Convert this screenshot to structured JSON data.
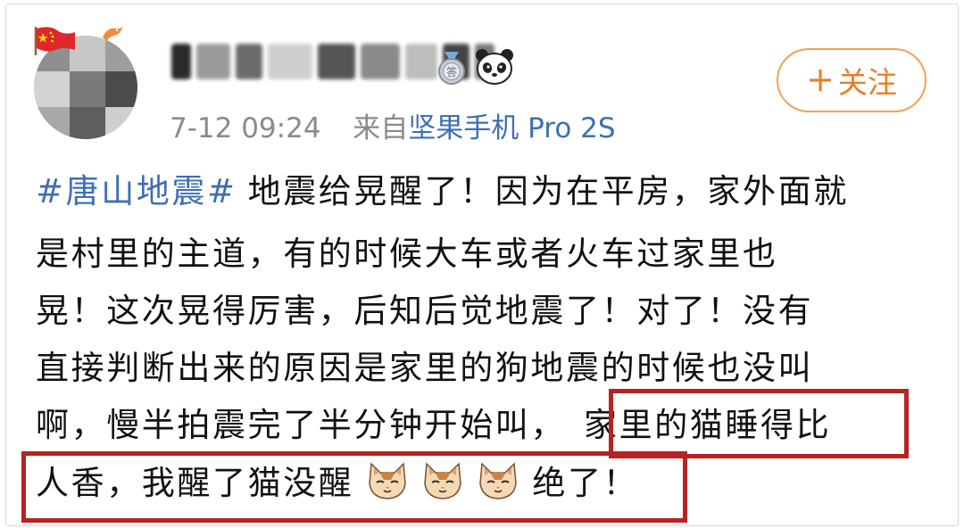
{
  "post": {
    "author": {
      "name": "▌▌▌▌▌▌▌▌▌",
      "avatar": "pixelated-avatar",
      "badges": [
        "china-flag-icon",
        "bird-icon",
        "medal-icon",
        "panda-icon"
      ]
    },
    "timestamp": "7-12 09:24",
    "source_prefix": "来自",
    "device": "坚果手机 Pro 2S",
    "follow_label": "关注",
    "follow_icon": "+",
    "hashtag": "#唐山地震#",
    "lines": [
      "地震给晃醒了！因为在平房，家外面就",
      "是村里的主道，有的时候大车或者火车过家里也",
      "晃！这次晃得厉害，后知后觉地震了！对了！没有",
      "直接判断出来的原因是家里的狗地震的时候也没叫",
      "啊，慢半拍震完了半分钟开始叫，",
      "家里的猫睡得比",
      "人香，我醒了猫没醒",
      "绝了！"
    ],
    "emoji": [
      "cat-face-icon",
      "cat-face-icon",
      "cat-face-icon"
    ]
  },
  "colors": {
    "link": "#3e6fb4",
    "follow": "#e87f24",
    "highlight_box": "#b72323",
    "meta_gray": "#8a8a8a"
  }
}
